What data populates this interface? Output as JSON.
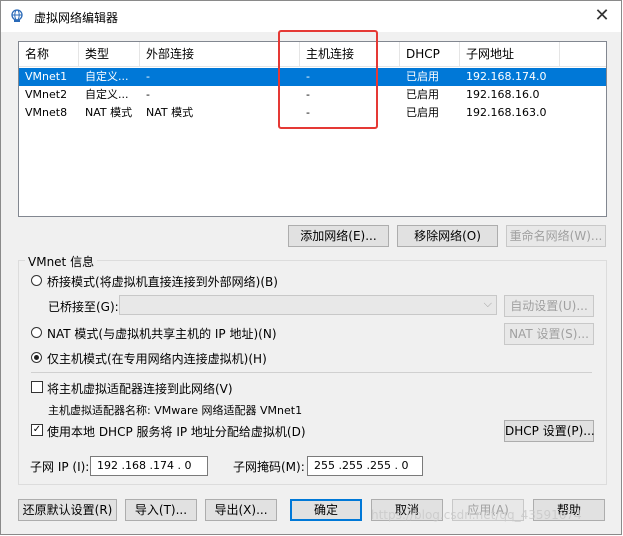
{
  "window": {
    "title": "虚拟网络编辑器",
    "close_glyph": "✕"
  },
  "table": {
    "headers": [
      "名称",
      "类型",
      "外部连接",
      "主机连接",
      "DHCP",
      "子网地址"
    ],
    "rows": [
      {
        "name": "VMnet1",
        "type": "自定义...",
        "external": "-",
        "host": "-",
        "dhcp": "已启用",
        "subnet": "192.168.174.0",
        "selected": true
      },
      {
        "name": "VMnet2",
        "type": "自定义...",
        "external": "-",
        "host": "-",
        "dhcp": "已启用",
        "subnet": "192.168.16.0",
        "selected": false
      },
      {
        "name": "VMnet8",
        "type": "NAT 模式",
        "external": "NAT 模式",
        "host": "-",
        "dhcp": "已启用",
        "subnet": "192.168.163.0",
        "selected": false
      }
    ]
  },
  "list_buttons": {
    "add": "添加网络(E)...",
    "remove": "移除网络(O)",
    "rename": "重命名网络(W)..."
  },
  "vmnet_info": {
    "label": "VMnet 信息",
    "bridged": "桥接模式(将虚拟机直接连接到外部网络)(B)",
    "bridged_to": "已桥接至(G):",
    "auto_settings": "自动设置(U)...",
    "nat": "NAT 模式(与虚拟机共享主机的 IP 地址)(N)",
    "nat_settings": "NAT 设置(S)...",
    "host_only": "仅主机模式(在专用网络内连接虚拟机)(H)",
    "connect_adapter": "将主机虚拟适配器连接到此网络(V)",
    "adapter_name": "主机虚拟适配器名称: VMware 网络适配器 VMnet1",
    "use_dhcp": "使用本地 DHCP 服务将 IP 地址分配给虚拟机(D)",
    "dhcp_settings": "DHCP 设置(P)...",
    "subnet_ip_label": "子网 IP (I):",
    "subnet_ip": "192 .168 .174 . 0",
    "subnet_mask_label": "子网掩码(M):",
    "subnet_mask": "255 .255 .255 . 0"
  },
  "footer": {
    "restore": "还原默认设置(R)",
    "import": "导入(T)...",
    "export": "导出(X)...",
    "ok": "确定",
    "cancel": "取消",
    "apply": "应用(A)",
    "help": "帮助"
  },
  "watermark": "https://blog.csdn.net/qq_43591674"
}
